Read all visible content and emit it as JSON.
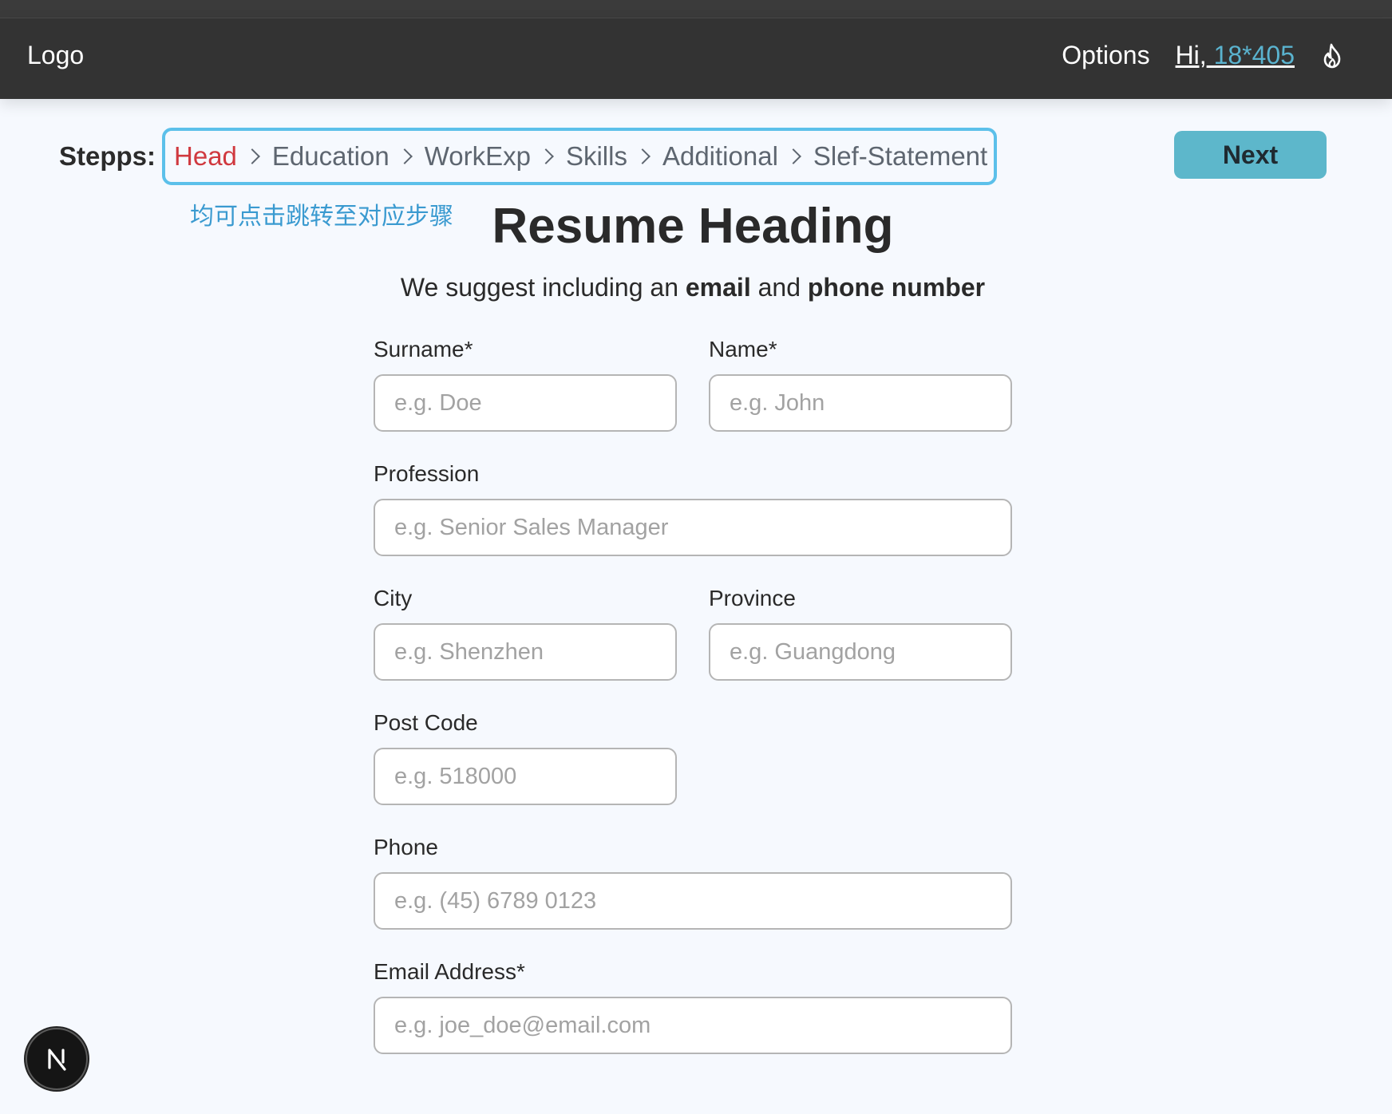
{
  "navbar": {
    "logo": "Logo",
    "options_label": "Options",
    "greeting_prefix": "Hi,",
    "username": " 18*405",
    "flame_icon": "flame-icon"
  },
  "steps": {
    "label": "Stepps:",
    "items": [
      "Head",
      "Education",
      "WorkExp",
      "Skills",
      "Additional",
      "Slef-Statement"
    ],
    "active": "Head",
    "annotation": "均可点击跳转至对应步骤",
    "next_label": "Next"
  },
  "page": {
    "title": "Resume Heading",
    "subtitle_part1": "We suggest including an ",
    "subtitle_bold1": "email",
    "subtitle_part2": " and ",
    "subtitle_bold2": "phone number"
  },
  "form": {
    "surname": {
      "label": "Surname*",
      "placeholder": "e.g. Doe",
      "value": ""
    },
    "name": {
      "label": "Name*",
      "placeholder": "e.g. John",
      "value": ""
    },
    "profession": {
      "label": "Profession",
      "placeholder": "e.g. Senior Sales Manager",
      "value": ""
    },
    "city": {
      "label": "City",
      "placeholder": "e.g. Shenzhen",
      "value": ""
    },
    "province": {
      "label": "Province",
      "placeholder": "e.g. Guangdong",
      "value": ""
    },
    "postcode": {
      "label": "Post Code",
      "placeholder": "e.g. 518000",
      "value": ""
    },
    "phone": {
      "label": "Phone",
      "placeholder": "e.g. (45) 6789 0123",
      "value": ""
    },
    "email": {
      "label": "Email Address*",
      "placeholder": "e.g. joe_doe@email.com",
      "value": ""
    }
  },
  "colors": {
    "navbar_bg": "#333333",
    "page_bg": "#f6f9fe",
    "active_step": "#d0393f",
    "steps_border": "#5cc0ea",
    "next_button": "#5db7cb",
    "annotation": "#3a9ad0",
    "username_link": "#5ab3cf"
  },
  "badge": {
    "letter": "N"
  }
}
